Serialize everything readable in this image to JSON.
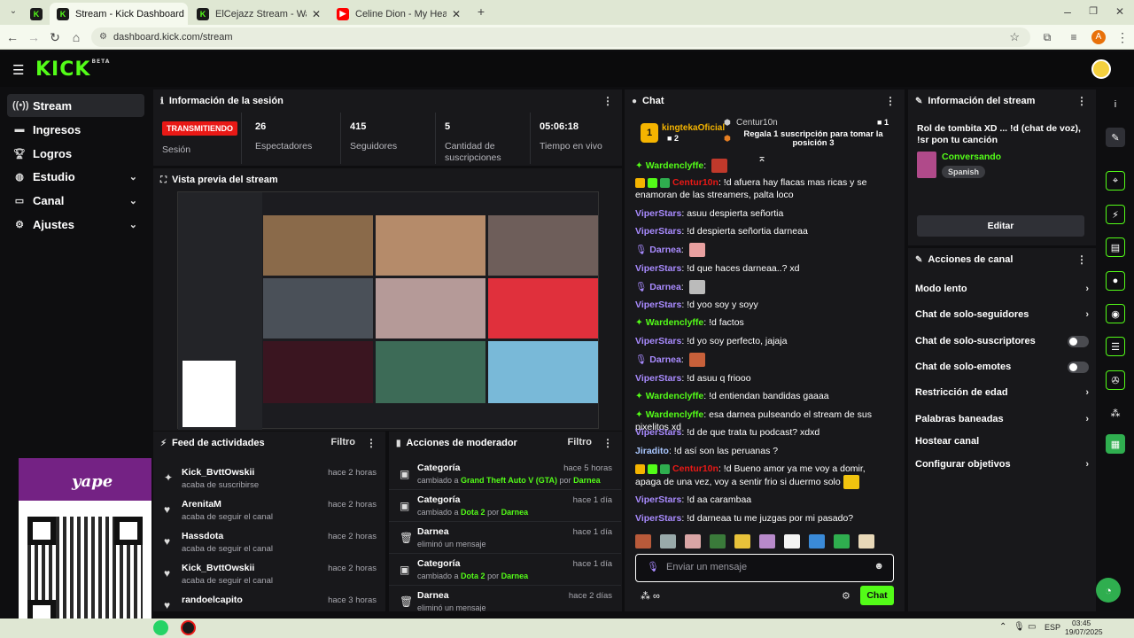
{
  "browser": {
    "tabs": [
      {
        "title": "Stream - Kick Dashboard",
        "active": true
      },
      {
        "title": "ElCejazz Stream - Watch Live o",
        "active": false
      },
      {
        "title": "Celine Dion - My Heart Will Go",
        "active": false
      }
    ],
    "url": "dashboard.kick.com/stream",
    "profile_initial": "A"
  },
  "brand": {
    "logo": "KICK",
    "beta": "BETA",
    "accent": "#53fc18"
  },
  "sidebar": {
    "items": [
      {
        "label": "Stream",
        "icon": "broadcast-icon",
        "active": true
      },
      {
        "label": "Ingresos",
        "icon": "wallet-icon"
      },
      {
        "label": "Logros",
        "icon": "trophy-icon"
      },
      {
        "label": "Estudio",
        "icon": "studio-icon",
        "expandable": true
      },
      {
        "label": "Canal",
        "icon": "channel-icon",
        "expandable": true
      },
      {
        "label": "Ajustes",
        "icon": "gear-icon",
        "expandable": true
      }
    ]
  },
  "session": {
    "title": "Información de la sesión",
    "live_badge": "TRANSMITIENDO",
    "live_label": "Sesión",
    "stats": [
      {
        "value": "26",
        "label": "Espectadores"
      },
      {
        "value": "415",
        "label": "Seguidores"
      },
      {
        "value": "5",
        "label": "Cantidad de suscripciones"
      },
      {
        "value": "05:06:18",
        "label": "Tiempo en vivo"
      }
    ]
  },
  "preview": {
    "title": "Vista previa del stream"
  },
  "activity": {
    "title": "Feed de actividades",
    "filter": "Filtro",
    "rows": [
      {
        "name": "Kick_BvttOwskii",
        "action": "acaba de suscribirse",
        "time": "hace 2 horas",
        "icon": "sparkle-icon"
      },
      {
        "name": "ArenitaM",
        "action": "acaba de seguir el canal",
        "time": "hace 2 horas",
        "icon": "heart-icon"
      },
      {
        "name": "Hassdota",
        "action": "acaba de seguir el canal",
        "time": "hace 2 horas",
        "icon": "heart-icon"
      },
      {
        "name": "Kick_BvttOwskii",
        "action": "acaba de seguir el canal",
        "time": "hace 2 horas",
        "icon": "heart-icon"
      },
      {
        "name": "randoelcapito",
        "action": "",
        "time": "hace 3 horas",
        "icon": "heart-icon"
      }
    ]
  },
  "mod_actions": {
    "title": "Acciones de moderador",
    "filter": "Filtro",
    "rows": [
      {
        "name": "Categoría",
        "pre": "cambiado a",
        "target": "Grand Theft Auto V (GTA)",
        "mid": "por",
        "by": "Darnea",
        "time": "hace 5 horas",
        "icon": "category-icon"
      },
      {
        "name": "Categoría",
        "pre": "cambiado a",
        "target": "Dota 2",
        "mid": "por",
        "by": "Darnea",
        "time": "hace 1 día",
        "icon": "category-icon"
      },
      {
        "name": "Darnea",
        "pre": "eliminó un mensaje",
        "target": "",
        "mid": "",
        "by": "",
        "time": "hace 1 día",
        "icon": "trash-icon"
      },
      {
        "name": "Categoría",
        "pre": "cambiado a",
        "target": "Dota 2",
        "mid": "por",
        "by": "Darnea",
        "time": "hace 1 día",
        "icon": "category-icon"
      },
      {
        "name": "Darnea",
        "pre": "eliminó un mensaje",
        "target": "",
        "mid": "",
        "by": "",
        "time": "hace 2 días",
        "icon": "trash-icon"
      }
    ]
  },
  "chat": {
    "title": "Chat",
    "pinned_user": "kingtekaOficial",
    "pinned_count": "2",
    "gift_user": "Centur10n",
    "gift_count": "1",
    "gift_text": "Regala 1 suscripción para tomar la posición 3",
    "messages": [
      {
        "user": "Wardenclyffe",
        "text": "",
        "color": "g"
      },
      {
        "user": "Centur10n",
        "text": "!d afuera hay flacas mas ricas y se enamoran de las streamers, palta loco",
        "color": "r"
      },
      {
        "user": "ViperStars",
        "text": "asuu despierta señortia",
        "color": "v"
      },
      {
        "user": "ViperStars",
        "text": "!d despierta señortia darneaa",
        "color": "v"
      },
      {
        "user": "Darnea",
        "text": "",
        "color": "v"
      },
      {
        "user": "ViperStars",
        "text": "!d que haces darneaa..? xd",
        "color": "v"
      },
      {
        "user": "Darnea",
        "text": "",
        "color": "v"
      },
      {
        "user": "ViperStars",
        "text": "!d yoo soy y soyy",
        "color": "v"
      },
      {
        "user": "Wardenclyffe",
        "text": "!d factos",
        "color": "g"
      },
      {
        "user": "ViperStars",
        "text": "!d yo soy perfecto, jajaja",
        "color": "v"
      },
      {
        "user": "Darnea",
        "text": "",
        "color": "v"
      },
      {
        "user": "ViperStars",
        "text": "!d asuu q friooo",
        "color": "v"
      },
      {
        "user": "Wardenclyffe",
        "text": "!d entiendan bandidas gaaaa",
        "color": "g"
      },
      {
        "user": "Wardenclyffe",
        "text": "esa darnea pulseando el stream de sus pixelitos xd",
        "color": "g"
      },
      {
        "user": "ViperStars",
        "text": "!d de que trata tu podcast? xdxd",
        "color": "v"
      },
      {
        "user": "Jiradito",
        "text": "!d así son las peruanas ?",
        "color": "b"
      },
      {
        "user": "Centur10n",
        "text": "!d Bueno amor ya me voy a domir, apaga de una vez, voy a sentir frio si duermo solo",
        "color": "r"
      },
      {
        "user": "ViperStars",
        "text": "!d aa carambaa",
        "color": "v"
      },
      {
        "user": "ViperStars",
        "text": "!d darneaa tu me juzgas por mi pasado?",
        "color": "v"
      }
    ],
    "input_placeholder": "Enviar un mensaje",
    "send_label": "Chat"
  },
  "stream_info": {
    "title": "Información del stream",
    "stream_title": "Rol de tombita XD ... !d (chat de voz), !sr pon tu canción",
    "category": "Conversando",
    "language": "Spanish",
    "edit_label": "Editar"
  },
  "channel_actions": {
    "title": "Acciones de canal",
    "items": [
      {
        "label": "Modo lento",
        "kind": "chevron"
      },
      {
        "label": "Chat de solo-seguidores",
        "kind": "chevron"
      },
      {
        "label": "Chat de solo-suscriptores",
        "kind": "toggle"
      },
      {
        "label": "Chat de solo-emotes",
        "kind": "toggle"
      },
      {
        "label": "Restricción de edad",
        "kind": "chevron"
      },
      {
        "label": "Palabras baneadas",
        "kind": "chevron"
      },
      {
        "label": "Hostear canal",
        "kind": "none"
      },
      {
        "label": "Configurar objetivos",
        "kind": "chevron"
      }
    ]
  },
  "taskbar": {
    "lang": "ESP",
    "time": "03:45",
    "date": "19/07/2025"
  },
  "overlay": {
    "brand": "yape"
  }
}
